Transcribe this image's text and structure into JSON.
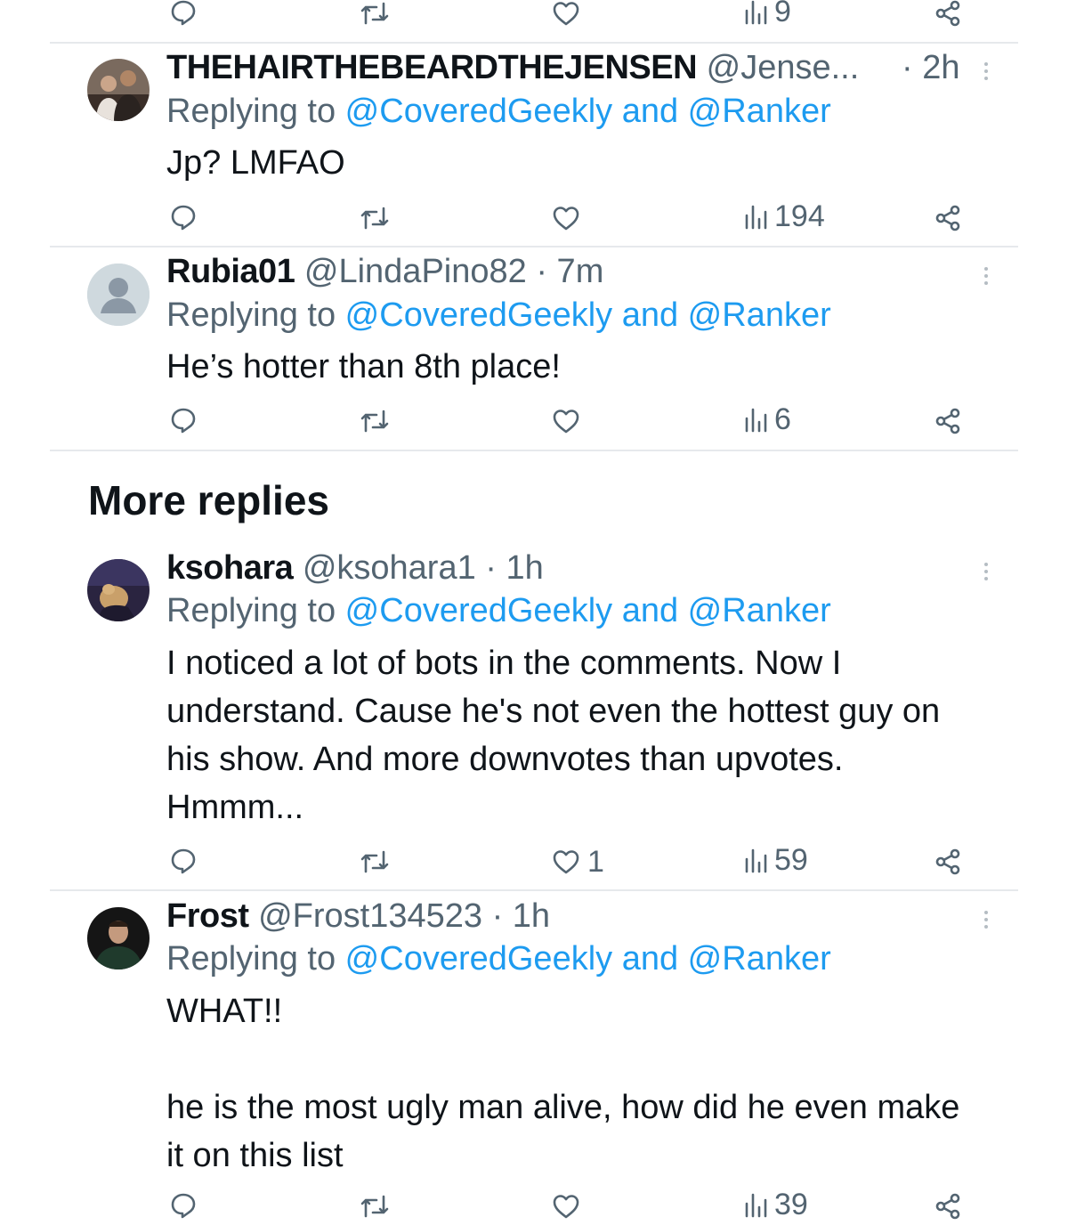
{
  "top_actions": {
    "views": "9"
  },
  "section": {
    "more_replies": "More replies"
  },
  "tweets": [
    {
      "name": "THEHAIRTHEBEARDTHEJENSEN",
      "handle": "@Jense...",
      "time": "· 2h",
      "replying_prefix": "Replying to ",
      "mention": "@CoveredGeekly and @Ranker",
      "body": "Jp? LMFAO",
      "likes": "",
      "views": "194"
    },
    {
      "name": "Rubia01",
      "handle": "@LindaPino82",
      "time": "· 7m",
      "replying_prefix": "Replying to ",
      "mention": "@CoveredGeekly and @Ranker",
      "body": "He’s hotter than 8th place!",
      "likes": "",
      "views": "6"
    },
    {
      "name": "ksohara",
      "handle": "@ksohara1",
      "time": "· 1h",
      "replying_prefix": "Replying to ",
      "mention": "@CoveredGeekly and @Ranker",
      "body": "I noticed a lot of bots in the comments. Now I understand. Cause he's not even the hottest guy on his show. And more downvotes than upvotes. Hmmm...",
      "likes": "1",
      "views": "59"
    },
    {
      "name": "Frost",
      "handle": "@Frost134523",
      "time": "· 1h",
      "replying_prefix": "Replying to ",
      "mention": "@CoveredGeekly and @Ranker",
      "body": "WHAT!!\n\nhe is the most ugly man alive, how did he even make it on this list",
      "likes": "",
      "views": "39"
    }
  ],
  "icons": {
    "reply": "reply-icon",
    "retweet": "retweet-icon",
    "like": "heart-icon",
    "views": "views-icon",
    "share": "share-icon",
    "more": "more-options-icon"
  },
  "colors": {
    "link": "#1d9bf0",
    "secondary": "#536471",
    "text": "#0f1419",
    "divider": "#e6e9ec"
  }
}
